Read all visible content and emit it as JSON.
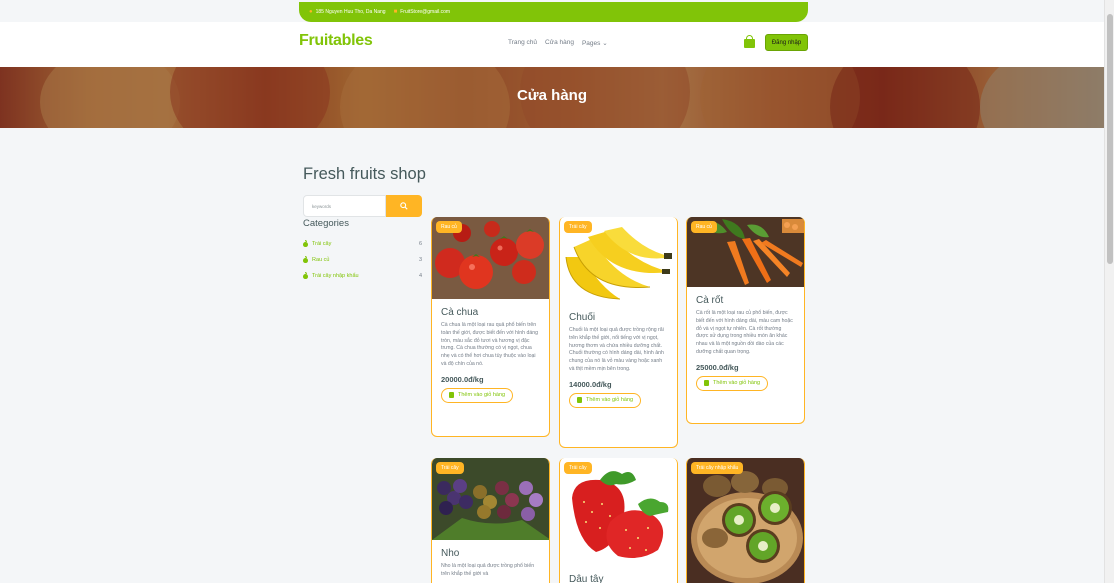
{
  "topbar": {
    "address": "185 Nguyen Huu Tho, Da Nang",
    "email": "FruitStore@gmail.com"
  },
  "header": {
    "logo": "Fruitables",
    "nav": [
      "Trang chủ",
      "Cửa hàng",
      "Pages"
    ],
    "login_label": "Đăng nhập"
  },
  "hero": {
    "title": "Cửa hàng"
  },
  "shop": {
    "title": "Fresh fruits shop",
    "search_placeholder": "keywords",
    "categories_title": "Categories",
    "categories": [
      {
        "label": "Trái cây",
        "count": "6"
      },
      {
        "label": "Rau củ",
        "count": "3"
      },
      {
        "label": "Trái cây nhập khẩu",
        "count": "4"
      }
    ]
  },
  "products": [
    {
      "badge": "Rau củ",
      "name": "Cà chua",
      "desc": "Cà chua là một loại rau quả phổ biến trên toàn thế giới, được biết đến với hình dáng tròn, màu sắc đỏ tươi và hương vị đặc trưng. Cà chua thường có vị ngọt, chua nhẹ và có thể hơi chua tùy thuộc vào loại và độ chín của nó.",
      "price": "20000.0đ/kg",
      "add_label": "Thêm vào giỏ hàng"
    },
    {
      "badge": "Trái cây",
      "name": "Chuối",
      "desc": "Chuối là một loại quả được trồng rộng rãi trên khắp thế giới, nổi tiếng với vị ngọt, hương thơm và chứa nhiều dưỡng chất. Chuối thường có hình dáng dài, hình ảnh chung của nó là vỏ màu vàng hoặc xanh và thịt mềm mịn bên trong.",
      "price": "14000.0đ/kg",
      "add_label": "Thêm vào giỏ hàng"
    },
    {
      "badge": "Rau củ",
      "name": "Cà rốt",
      "desc": "Cà rốt là một loại rau củ phổ biến, được biết đến với hình dáng dài, màu cam hoặc đỏ và vị ngọt tự nhiên. Cà rốt thường được sử dụng trong nhiều món ăn khác nhau và là một nguồn dồi dào của các dưỡng chất quan trọng.",
      "price": "25000.0đ/kg",
      "add_label": "Thêm vào giỏ hàng"
    },
    {
      "badge": "Trái cây",
      "name": "Nho",
      "desc": "Nho là một loại quả được trồng phổ biến trên khắp thế giới và"
    },
    {
      "badge": "Trái cây",
      "name": "Dâu tây"
    },
    {
      "badge": "Trái cây nhập khẩu"
    }
  ]
}
